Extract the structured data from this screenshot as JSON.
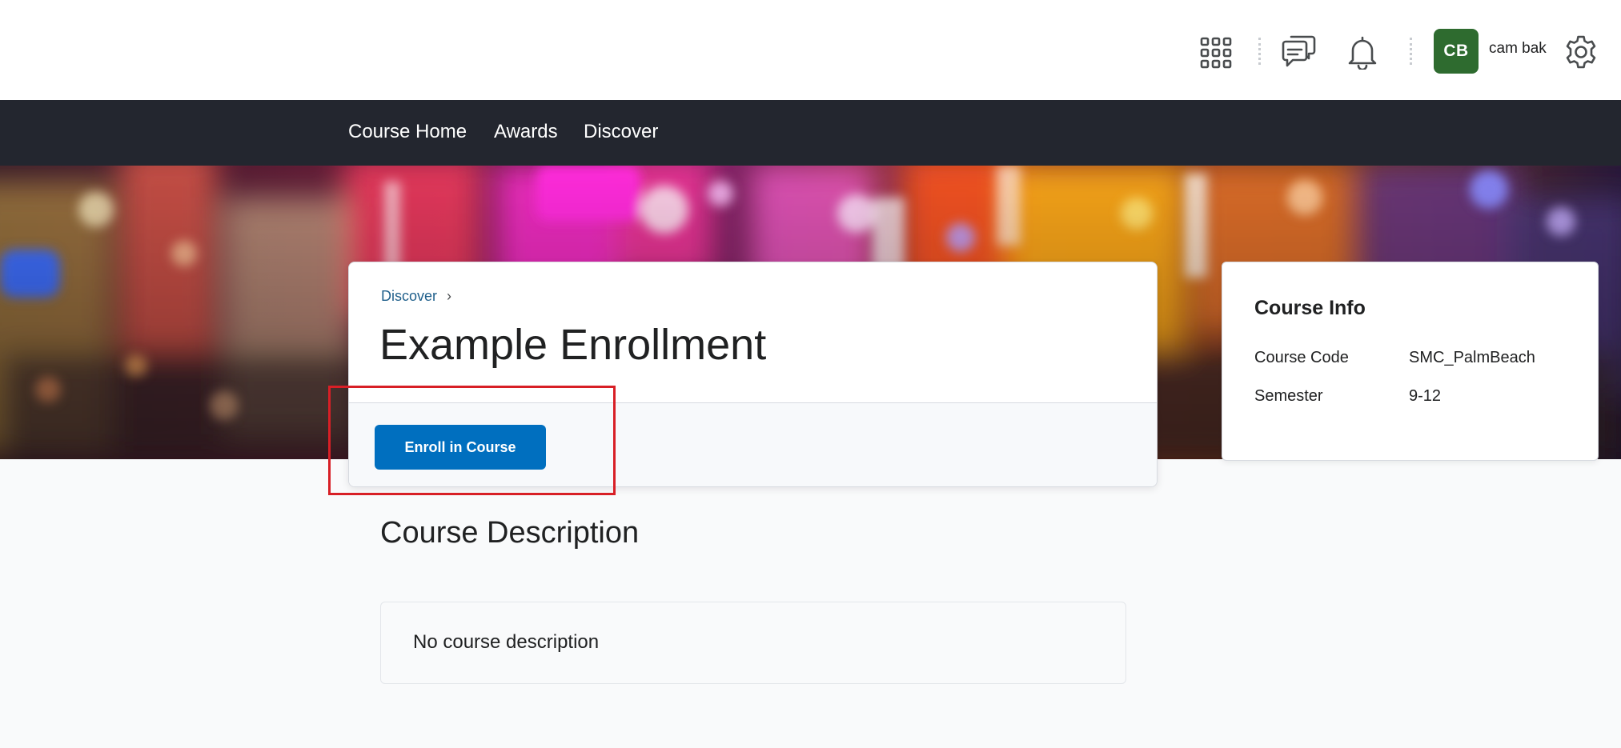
{
  "header": {
    "waffle_icon": "grid-icon",
    "messages_icon": "chat-bubbles-icon",
    "notifications_icon": "bell-icon",
    "settings_icon": "gear-icon",
    "user": {
      "initials": "CB",
      "name": "cam bak",
      "avatar_color": "#2e6b2f"
    }
  },
  "nav": {
    "items": [
      {
        "label": "Course Home"
      },
      {
        "label": "Awards"
      },
      {
        "label": "Discover"
      }
    ]
  },
  "course": {
    "breadcrumb": {
      "link": "Discover",
      "separator": "›"
    },
    "title": "Example Enrollment",
    "enroll_label": "Enroll in Course",
    "accent_color": "#006fbf"
  },
  "info": {
    "title": "Course Info",
    "rows": [
      {
        "key": "Course Code",
        "value": "SMC_PalmBeach"
      },
      {
        "key": "Semester",
        "value": "9-12"
      }
    ]
  },
  "description": {
    "heading": "Course Description",
    "text": "No course description"
  },
  "highlight_color": "#d81f26"
}
